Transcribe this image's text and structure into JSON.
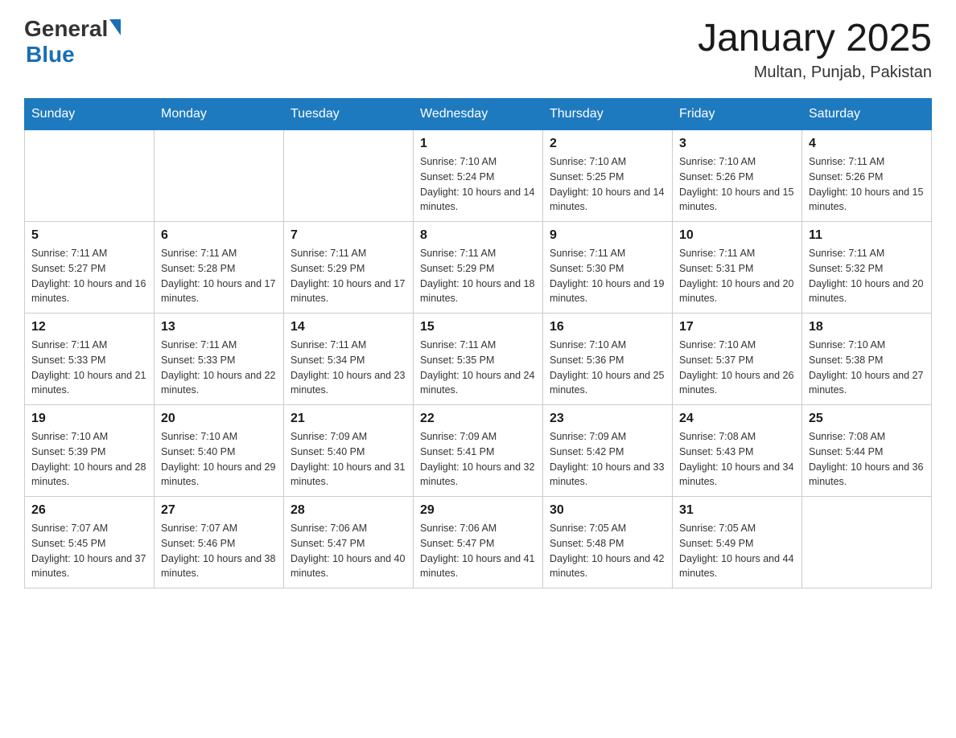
{
  "logo": {
    "general": "General",
    "blue": "Blue"
  },
  "title": "January 2025",
  "location": "Multan, Punjab, Pakistan",
  "days_of_week": [
    "Sunday",
    "Monday",
    "Tuesday",
    "Wednesday",
    "Thursday",
    "Friday",
    "Saturday"
  ],
  "weeks": [
    [
      {
        "day": "",
        "info": ""
      },
      {
        "day": "",
        "info": ""
      },
      {
        "day": "",
        "info": ""
      },
      {
        "day": "1",
        "info": "Sunrise: 7:10 AM\nSunset: 5:24 PM\nDaylight: 10 hours and 14 minutes."
      },
      {
        "day": "2",
        "info": "Sunrise: 7:10 AM\nSunset: 5:25 PM\nDaylight: 10 hours and 14 minutes."
      },
      {
        "day": "3",
        "info": "Sunrise: 7:10 AM\nSunset: 5:26 PM\nDaylight: 10 hours and 15 minutes."
      },
      {
        "day": "4",
        "info": "Sunrise: 7:11 AM\nSunset: 5:26 PM\nDaylight: 10 hours and 15 minutes."
      }
    ],
    [
      {
        "day": "5",
        "info": "Sunrise: 7:11 AM\nSunset: 5:27 PM\nDaylight: 10 hours and 16 minutes."
      },
      {
        "day": "6",
        "info": "Sunrise: 7:11 AM\nSunset: 5:28 PM\nDaylight: 10 hours and 17 minutes."
      },
      {
        "day": "7",
        "info": "Sunrise: 7:11 AM\nSunset: 5:29 PM\nDaylight: 10 hours and 17 minutes."
      },
      {
        "day": "8",
        "info": "Sunrise: 7:11 AM\nSunset: 5:29 PM\nDaylight: 10 hours and 18 minutes."
      },
      {
        "day": "9",
        "info": "Sunrise: 7:11 AM\nSunset: 5:30 PM\nDaylight: 10 hours and 19 minutes."
      },
      {
        "day": "10",
        "info": "Sunrise: 7:11 AM\nSunset: 5:31 PM\nDaylight: 10 hours and 20 minutes."
      },
      {
        "day": "11",
        "info": "Sunrise: 7:11 AM\nSunset: 5:32 PM\nDaylight: 10 hours and 20 minutes."
      }
    ],
    [
      {
        "day": "12",
        "info": "Sunrise: 7:11 AM\nSunset: 5:33 PM\nDaylight: 10 hours and 21 minutes."
      },
      {
        "day": "13",
        "info": "Sunrise: 7:11 AM\nSunset: 5:33 PM\nDaylight: 10 hours and 22 minutes."
      },
      {
        "day": "14",
        "info": "Sunrise: 7:11 AM\nSunset: 5:34 PM\nDaylight: 10 hours and 23 minutes."
      },
      {
        "day": "15",
        "info": "Sunrise: 7:11 AM\nSunset: 5:35 PM\nDaylight: 10 hours and 24 minutes."
      },
      {
        "day": "16",
        "info": "Sunrise: 7:10 AM\nSunset: 5:36 PM\nDaylight: 10 hours and 25 minutes."
      },
      {
        "day": "17",
        "info": "Sunrise: 7:10 AM\nSunset: 5:37 PM\nDaylight: 10 hours and 26 minutes."
      },
      {
        "day": "18",
        "info": "Sunrise: 7:10 AM\nSunset: 5:38 PM\nDaylight: 10 hours and 27 minutes."
      }
    ],
    [
      {
        "day": "19",
        "info": "Sunrise: 7:10 AM\nSunset: 5:39 PM\nDaylight: 10 hours and 28 minutes."
      },
      {
        "day": "20",
        "info": "Sunrise: 7:10 AM\nSunset: 5:40 PM\nDaylight: 10 hours and 29 minutes."
      },
      {
        "day": "21",
        "info": "Sunrise: 7:09 AM\nSunset: 5:40 PM\nDaylight: 10 hours and 31 minutes."
      },
      {
        "day": "22",
        "info": "Sunrise: 7:09 AM\nSunset: 5:41 PM\nDaylight: 10 hours and 32 minutes."
      },
      {
        "day": "23",
        "info": "Sunrise: 7:09 AM\nSunset: 5:42 PM\nDaylight: 10 hours and 33 minutes."
      },
      {
        "day": "24",
        "info": "Sunrise: 7:08 AM\nSunset: 5:43 PM\nDaylight: 10 hours and 34 minutes."
      },
      {
        "day": "25",
        "info": "Sunrise: 7:08 AM\nSunset: 5:44 PM\nDaylight: 10 hours and 36 minutes."
      }
    ],
    [
      {
        "day": "26",
        "info": "Sunrise: 7:07 AM\nSunset: 5:45 PM\nDaylight: 10 hours and 37 minutes."
      },
      {
        "day": "27",
        "info": "Sunrise: 7:07 AM\nSunset: 5:46 PM\nDaylight: 10 hours and 38 minutes."
      },
      {
        "day": "28",
        "info": "Sunrise: 7:06 AM\nSunset: 5:47 PM\nDaylight: 10 hours and 40 minutes."
      },
      {
        "day": "29",
        "info": "Sunrise: 7:06 AM\nSunset: 5:47 PM\nDaylight: 10 hours and 41 minutes."
      },
      {
        "day": "30",
        "info": "Sunrise: 7:05 AM\nSunset: 5:48 PM\nDaylight: 10 hours and 42 minutes."
      },
      {
        "day": "31",
        "info": "Sunrise: 7:05 AM\nSunset: 5:49 PM\nDaylight: 10 hours and 44 minutes."
      },
      {
        "day": "",
        "info": ""
      }
    ]
  ]
}
